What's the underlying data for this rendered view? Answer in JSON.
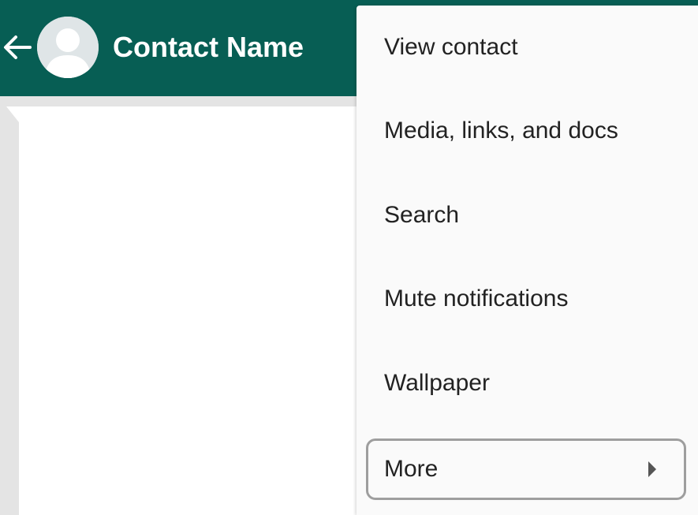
{
  "header": {
    "back_icon": "arrow-left-icon",
    "avatar_icon": "default-avatar-icon",
    "contact_name": "Contact Name"
  },
  "menu": {
    "items": [
      {
        "label": "View contact"
      },
      {
        "label": "Media, links, and docs"
      },
      {
        "label": "Search"
      },
      {
        "label": "Mute notifications"
      },
      {
        "label": "Wallpaper"
      },
      {
        "label": "More",
        "submenu_icon": "chevron-right-icon",
        "highlighted": true
      }
    ]
  },
  "colors": {
    "app_bar": "#075e54",
    "chat_background": "#e4e4e4",
    "menu_background": "#fafafa",
    "menu_text": "#222222",
    "highlight_border": "#9e9e9e"
  }
}
